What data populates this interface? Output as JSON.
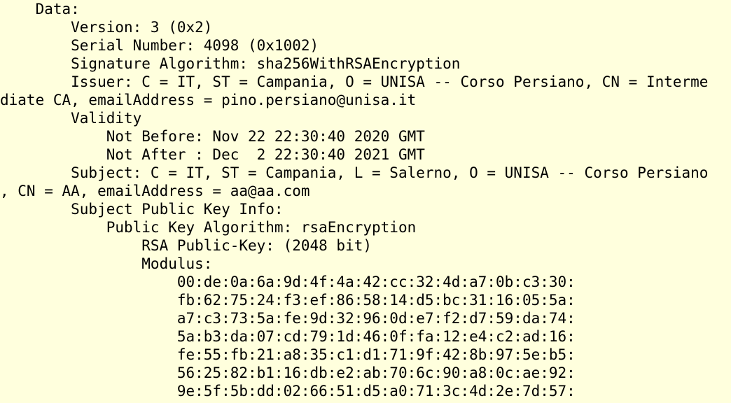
{
  "colors": {
    "background": "#ffffdd",
    "text": "#000000"
  },
  "certificate": {
    "lines": [
      "    Data:",
      "        Version: 3 (0x2)",
      "        Serial Number: 4098 (0x1002)",
      "        Signature Algorithm: sha256WithRSAEncryption",
      "        Issuer: C = IT, ST = Campania, O = UNISA -- Corso Persiano, CN = Interme",
      "diate CA, emailAddress = pino.persiano@unisa.it",
      "        Validity",
      "            Not Before: Nov 22 22:30:40 2020 GMT",
      "            Not After : Dec  2 22:30:40 2021 GMT",
      "        Subject: C = IT, ST = Campania, L = Salerno, O = UNISA -- Corso Persiano",
      ", CN = AA, emailAddress = aa@aa.com",
      "        Subject Public Key Info:",
      "            Public Key Algorithm: rsaEncryption",
      "                RSA Public-Key: (2048 bit)",
      "                Modulus:",
      "                    00:de:0a:6a:9d:4f:4a:42:cc:32:4d:a7:0b:c3:30:",
      "                    fb:62:75:24:f3:ef:86:58:14:d5:bc:31:16:05:5a:",
      "                    a7:c3:73:5a:fe:9d:32:96:0d:e7:f2:d7:59:da:74:",
      "                    5a:b3:da:07:cd:79:1d:46:0f:fa:12:e4:c2:ad:16:",
      "                    fe:55:fb:21:a8:35:c1:d1:71:9f:42:8b:97:5e:b5:",
      "                    56:25:82:b1:16:db:e2:ab:70:6c:90:a8:0c:ae:92:",
      "                    9e:5f:5b:dd:02:66:51:d5:a0:71:3c:4d:2e:7d:57:"
    ]
  }
}
